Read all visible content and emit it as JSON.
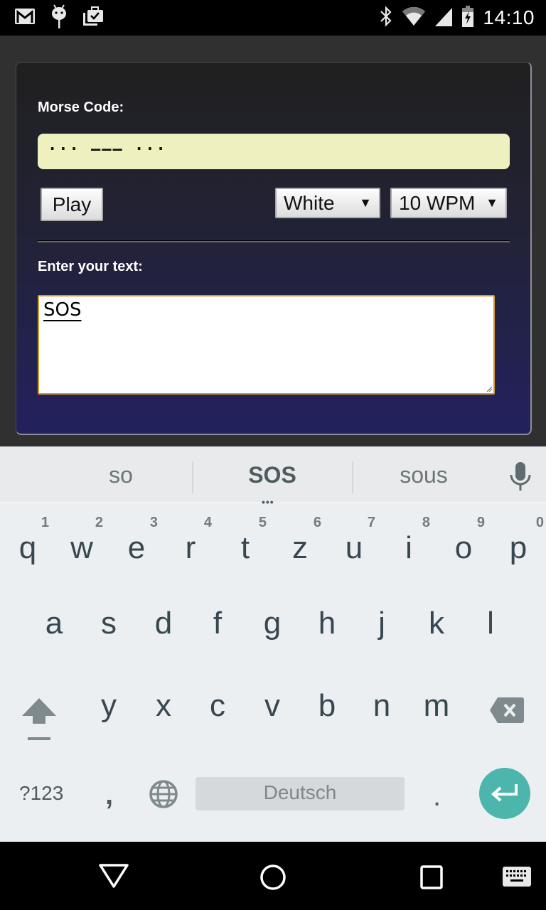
{
  "status_bar": {
    "notification_icons": [
      "gmail-icon",
      "android-debug-icon",
      "clipboard-check-icon"
    ],
    "system_icons": [
      "bluetooth-icon",
      "wifi-icon",
      "cell-signal-icon",
      "battery-charging-icon"
    ],
    "time": "14:10"
  },
  "page": {
    "morse_label": "Morse Code:",
    "morse_output": "··· ––– ···",
    "play_button": "Play",
    "color_select": {
      "selected": "White",
      "arrow": "▼"
    },
    "speed_select": {
      "selected": "10 WPM",
      "arrow": "▼"
    },
    "input_label": "Enter your text:",
    "input_value": "SOS",
    "colors": {
      "morse_bg": "#eef0c0",
      "textarea_border": "#d69a2a"
    }
  },
  "keyboard": {
    "suggestions": [
      "so",
      "SOS",
      "sous"
    ],
    "more_indicator": "•••",
    "row1": [
      {
        "key": "q",
        "hint": "1"
      },
      {
        "key": "w",
        "hint": "2"
      },
      {
        "key": "e",
        "hint": "3"
      },
      {
        "key": "r",
        "hint": "4"
      },
      {
        "key": "t",
        "hint": "5"
      },
      {
        "key": "z",
        "hint": "6"
      },
      {
        "key": "u",
        "hint": "7"
      },
      {
        "key": "i",
        "hint": "8"
      },
      {
        "key": "o",
        "hint": "9"
      },
      {
        "key": "p",
        "hint": "0"
      }
    ],
    "row2": [
      "a",
      "s",
      "d",
      "f",
      "g",
      "h",
      "j",
      "k",
      "l"
    ],
    "row3": [
      "y",
      "x",
      "c",
      "v",
      "b",
      "n",
      "m"
    ],
    "symbols_key": "?123",
    "comma_key": ",",
    "period_key": ".",
    "space_label": "Deutsch",
    "accent_color": "#4db6ac"
  },
  "navbar": {
    "buttons": [
      "back",
      "home",
      "recents",
      "keyboard-switch"
    ]
  }
}
